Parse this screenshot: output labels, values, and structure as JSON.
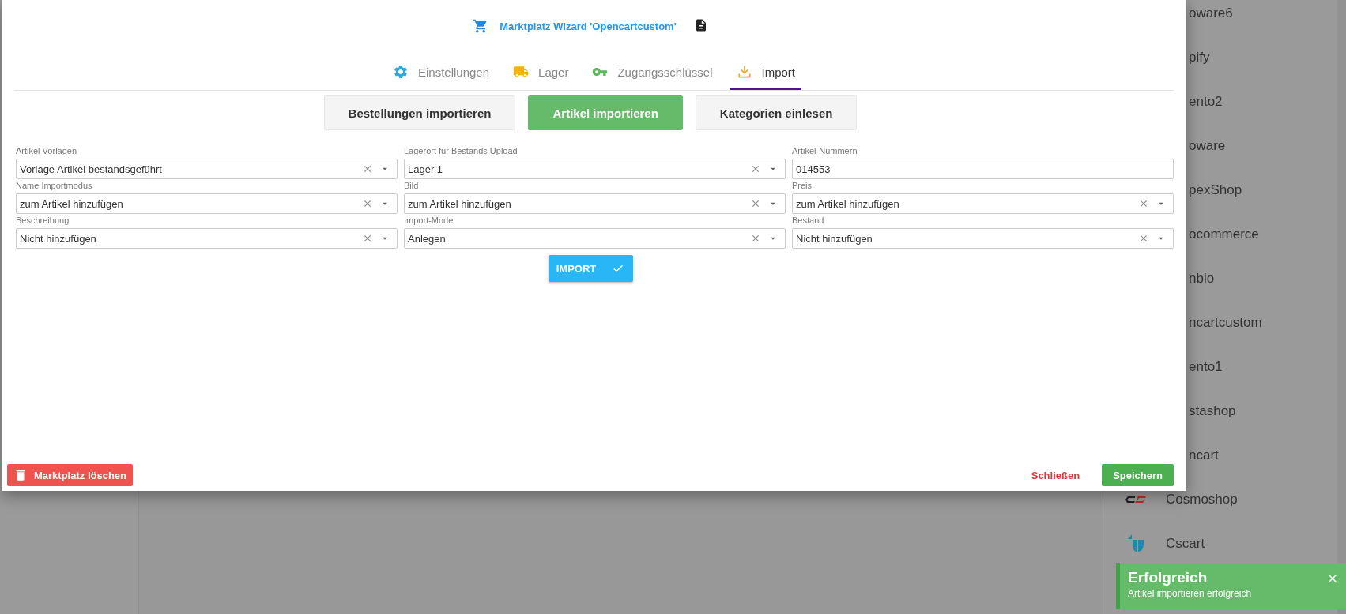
{
  "marketplace_list": {
    "items": [
      {
        "name": "oware6",
        "kind": "covered"
      },
      {
        "name": "pify",
        "kind": "covered"
      },
      {
        "name": "ento2",
        "kind": "covered"
      },
      {
        "name": "oware",
        "kind": "covered"
      },
      {
        "name": "pexShop",
        "kind": "covered"
      },
      {
        "name": "ocommerce",
        "kind": "covered"
      },
      {
        "name": "nbio",
        "kind": "covered"
      },
      {
        "name": "ncartcustom",
        "kind": "covered"
      },
      {
        "name": "ento1",
        "kind": "covered"
      },
      {
        "name": "stashop",
        "kind": "covered"
      },
      {
        "name": "ncart",
        "kind": "covered"
      },
      {
        "name": "Cosmoshop",
        "kind": "cs-logo"
      },
      {
        "name": "Cscart",
        "kind": "cube-logo"
      }
    ]
  },
  "dialog": {
    "title": "Marktplatz Wizard 'Opencartcustom'",
    "tabs": [
      {
        "label": "Einstellungen",
        "selected": false
      },
      {
        "label": "Lager",
        "selected": false
      },
      {
        "label": "Zugangsschlüssel",
        "selected": false
      },
      {
        "label": "Import",
        "selected": true
      }
    ],
    "actions": [
      {
        "label": "Bestellungen importieren",
        "selected": false
      },
      {
        "label": "Artikel importieren",
        "selected": true
      },
      {
        "label": "Kategorien einlesen",
        "selected": false
      }
    ],
    "fields": [
      {
        "label": "Artikel Vorlagen",
        "value": "Vorlage Artikel bestandsgeführt",
        "kind": "select"
      },
      {
        "label": "Lagerort für Bestands Upload",
        "value": "Lager 1",
        "kind": "select"
      },
      {
        "label": "Artikel-Nummern",
        "value": "014553",
        "kind": "text"
      },
      {
        "label": "Name Importmodus",
        "value": "zum Artikel hinzufügen",
        "kind": "select"
      },
      {
        "label": "Bild",
        "value": "zum Artikel hinzufügen",
        "kind": "select"
      },
      {
        "label": "Preis",
        "value": "zum Artikel hinzufügen",
        "kind": "select"
      },
      {
        "label": "Beschreibung",
        "value": "Nicht hinzufügen",
        "kind": "select"
      },
      {
        "label": "Import-Mode",
        "value": "Anlegen",
        "kind": "select"
      },
      {
        "label": "Bestand",
        "value": "Nicht hinzufügen",
        "kind": "select"
      }
    ],
    "import_button": "IMPORT",
    "delete_button": "Marktplatz löschen",
    "close_button": "Schließen",
    "save_button": "Speichern"
  },
  "toast": {
    "title": "Erfolgreich",
    "message": "Artikel importieren erfolgreich"
  }
}
